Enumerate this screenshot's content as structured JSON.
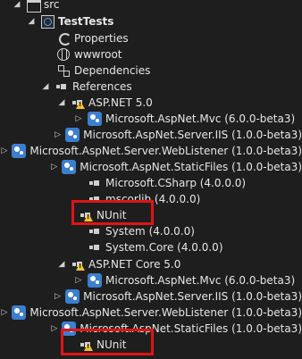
{
  "tree": {
    "src": "src",
    "project": "TestTests",
    "properties": "Properties",
    "wwwroot": "wwwroot",
    "dependencies": "Dependencies",
    "references": "References",
    "fx1": {
      "label": "ASP.NET 5.0",
      "items": [
        "Microsoft.AspNet.Mvc (6.0.0-beta3)",
        "Microsoft.AspNet.Server.IIS (1.0.0-beta3)",
        "Microsoft.AspNet.Server.WebListener (1.0.0-beta3)",
        "Microsoft.AspNet.StaticFiles (1.0.0-beta3)",
        "Microsoft.CSharp (4.0.0.0)",
        "mscorlib (4.0.0.0)",
        "NUnit",
        "System (4.0.0.0)",
        "System.Core (4.0.0.0)"
      ]
    },
    "fx2": {
      "label": "ASP.NET Core 5.0",
      "items": [
        "Microsoft.AspNet.Mvc (6.0.0-beta3)",
        "Microsoft.AspNet.Server.IIS (1.0.0-beta3)",
        "Microsoft.AspNet.Server.WebListener (1.0.0-beta3)",
        "Microsoft.AspNet.StaticFiles (1.0.0-beta3)",
        "NUnit"
      ]
    }
  }
}
